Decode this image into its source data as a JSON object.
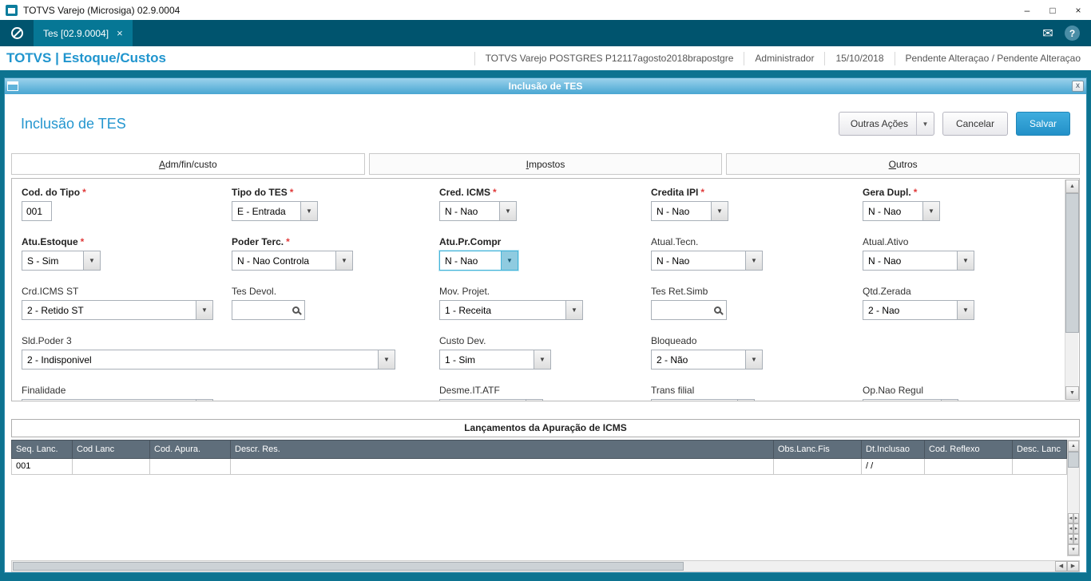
{
  "window": {
    "title": "TOTVS Varejo (Microsiga) 02.9.0004"
  },
  "icons": {
    "minimize": "–",
    "maximize": "□",
    "close": "×",
    "mail": "✉",
    "help": "?",
    "dialog_close": "x",
    "dropdown": "▼",
    "scroll_up": "▲",
    "scroll_down": "▼",
    "scroll_left": "◀",
    "scroll_right": "▶",
    "pair_left": "◂",
    "pair_right": "▸"
  },
  "tabbar": {
    "active_tab": "Tes [02.9.0004]",
    "tab_close": "×"
  },
  "topbar": {
    "brand": "TOTVS | Estoque/Custos",
    "environment": "TOTVS Varejo POSTGRES P12117agosto2018brapostgre",
    "user": "Administrador",
    "date": "15/10/2018",
    "status": "Pendente Alteraçao / Pendente Alteraçao"
  },
  "dialog": {
    "titlebar": "Inclusão de TES",
    "heading": "Inclusão de TES",
    "actions": {
      "other": "Outras Ações",
      "cancel": "Cancelar",
      "save": "Salvar"
    },
    "tabs": [
      {
        "accel": "A",
        "rest": "dm/fin/custo"
      },
      {
        "accel": "I",
        "rest": "mpostos"
      },
      {
        "accel": "O",
        "rest": "utros"
      }
    ]
  },
  "form": {
    "required_marker": "*",
    "fields": {
      "cod_tipo": {
        "label": "Cod. do Tipo",
        "value": "001",
        "required": true
      },
      "tipo_tes": {
        "label": "Tipo do TES",
        "value": "E - Entrada",
        "required": true
      },
      "cred_icms": {
        "label": "Cred. ICMS",
        "value": "N - Nao",
        "required": true
      },
      "credita_ipi": {
        "label": "Credita IPI",
        "value": "N - Nao",
        "required": true
      },
      "gera_dupl": {
        "label": "Gera Dupl.",
        "value": "N - Nao",
        "required": true
      },
      "atu_estoque": {
        "label": "Atu.Estoque",
        "value": "S - Sim",
        "required": true
      },
      "poder_terc": {
        "label": "Poder Terc.",
        "value": "N - Nao Controla",
        "required": true
      },
      "atu_pr_compr": {
        "label": "Atu.Pr.Compr",
        "value": "N - Nao",
        "required": false
      },
      "atual_tecn": {
        "label": "Atual.Tecn.",
        "value": "N - Nao",
        "required": false
      },
      "atual_ativo": {
        "label": "Atual.Ativo",
        "value": "N - Nao",
        "required": false
      },
      "crd_icms_st": {
        "label": "Crd.ICMS ST",
        "value": "2 - Retido ST",
        "required": false
      },
      "tes_devol": {
        "label": "Tes Devol.",
        "value": "",
        "required": false
      },
      "mov_projet": {
        "label": "Mov. Projet.",
        "value": "1 - Receita",
        "required": false
      },
      "tes_ret_simb": {
        "label": "Tes Ret.Simb",
        "value": "",
        "required": false
      },
      "qtd_zerada": {
        "label": "Qtd.Zerada",
        "value": "2 - Nao",
        "required": false
      },
      "sld_poder3": {
        "label": "Sld.Poder 3",
        "value": "2 - Indisponivel",
        "required": false
      },
      "custo_dev": {
        "label": "Custo Dev.",
        "value": "1 - Sim",
        "required": false
      },
      "bloqueado": {
        "label": "Bloqueado",
        "value": "2 - Não",
        "required": false
      },
      "finalidade": {
        "label": "Finalidade",
        "value": "",
        "required": false
      },
      "desme_it_atf": {
        "label": "Desme.IT.ATF",
        "value": "",
        "required": false
      },
      "trans_filial": {
        "label": "Trans filial",
        "value": "",
        "required": false
      },
      "op_nao_regul": {
        "label": "Op.Nao Regul",
        "value": "",
        "required": false
      }
    }
  },
  "grid": {
    "title": "Lançamentos da Apuração de ICMS",
    "columns": [
      "Seq. Lanc.",
      "Cod Lanc",
      "Cod. Apura.",
      "Descr. Res.",
      "Obs.Lanc.Fis",
      "Dt.Inclusao",
      "Cod. Reflexo",
      "Desc. Lanc"
    ],
    "rows": [
      {
        "seq_lanc": "001",
        "cod_lanc": "",
        "cod_apura": "",
        "descr_res": "",
        "obs_lanc_fis": "",
        "dt_inclusao": "/ /",
        "cod_reflexo": "",
        "desc_lanc": ""
      }
    ]
  }
}
